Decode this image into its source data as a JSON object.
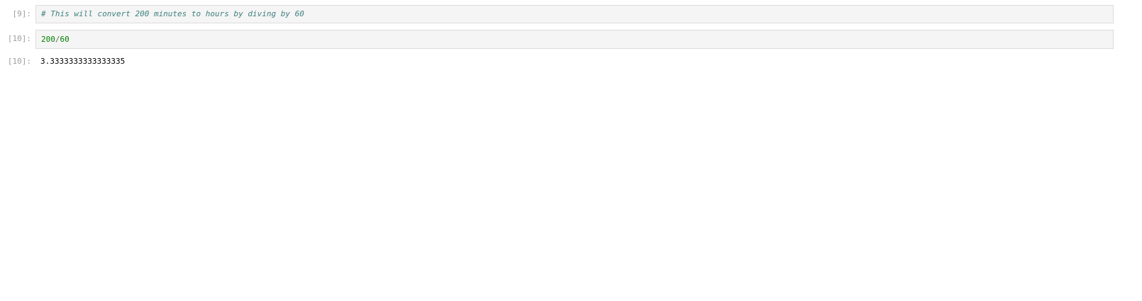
{
  "cells": [
    {
      "type": "code",
      "prompt": "[9]:",
      "source": "# This will convert 200 minutes to hours by diving by 60"
    },
    {
      "type": "code",
      "prompt": "[10]:",
      "source_tokens": {
        "num1": "200",
        "op": "/",
        "num2": "60"
      }
    },
    {
      "type": "output",
      "prompt": "[10]:",
      "text": "3.3333333333333335"
    }
  ],
  "colors": {
    "comment": "#408080",
    "number": "#008000",
    "operator": "#666666",
    "prompt": "#9e9e9e",
    "editor_bg": "#f5f5f5",
    "editor_border": "#dcdcdc"
  }
}
